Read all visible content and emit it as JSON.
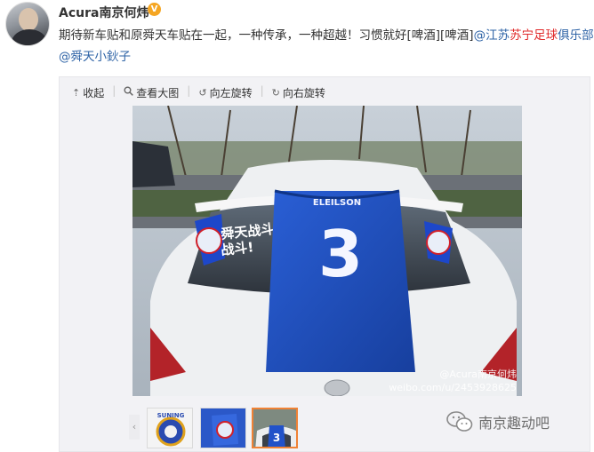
{
  "user": {
    "name": "Acura南京何炜",
    "verified_badge": "V",
    "badge_color": "#f5a623"
  },
  "post": {
    "text": "期待新车贴和原舜天车贴在一起，一种传承，一种超越！习惯就好[啤酒][啤酒]",
    "mention_prefix": "@江苏",
    "mention_highlight": "苏宁足球",
    "mention_suffix": "俱乐部",
    "mention2": "@舜天小鈥子",
    "link_color": "#2e63a6",
    "highlight_color": "#e0292a"
  },
  "toolbar": {
    "collapse": {
      "icon": "collapse-up-icon",
      "label": "收起"
    },
    "view_large": {
      "icon": "magnify-icon",
      "label": "查看大图"
    },
    "rotate_left": {
      "icon": "rotate-left-icon",
      "label": "向左旋转"
    },
    "rotate_right": {
      "icon": "rotate-right-icon",
      "label": "向右旋转"
    }
  },
  "photo": {
    "jersey_name": "ELEILSON",
    "jersey_number": "3",
    "sticker_text_line1": "舜天战斗",
    "sticker_text_line2": "战斗!",
    "watermark_line1": "@Acura南京何炜",
    "watermark_line2": "weibo.com/u/2453928625",
    "jersey_color": "#1f4fc0"
  },
  "thumbnails": {
    "selected_index": 2,
    "selected_border": "#f08235",
    "thumb1_text": "SUNING"
  },
  "account_watermark": {
    "icon": "wechat-icon",
    "text": "南京趣动吧"
  }
}
